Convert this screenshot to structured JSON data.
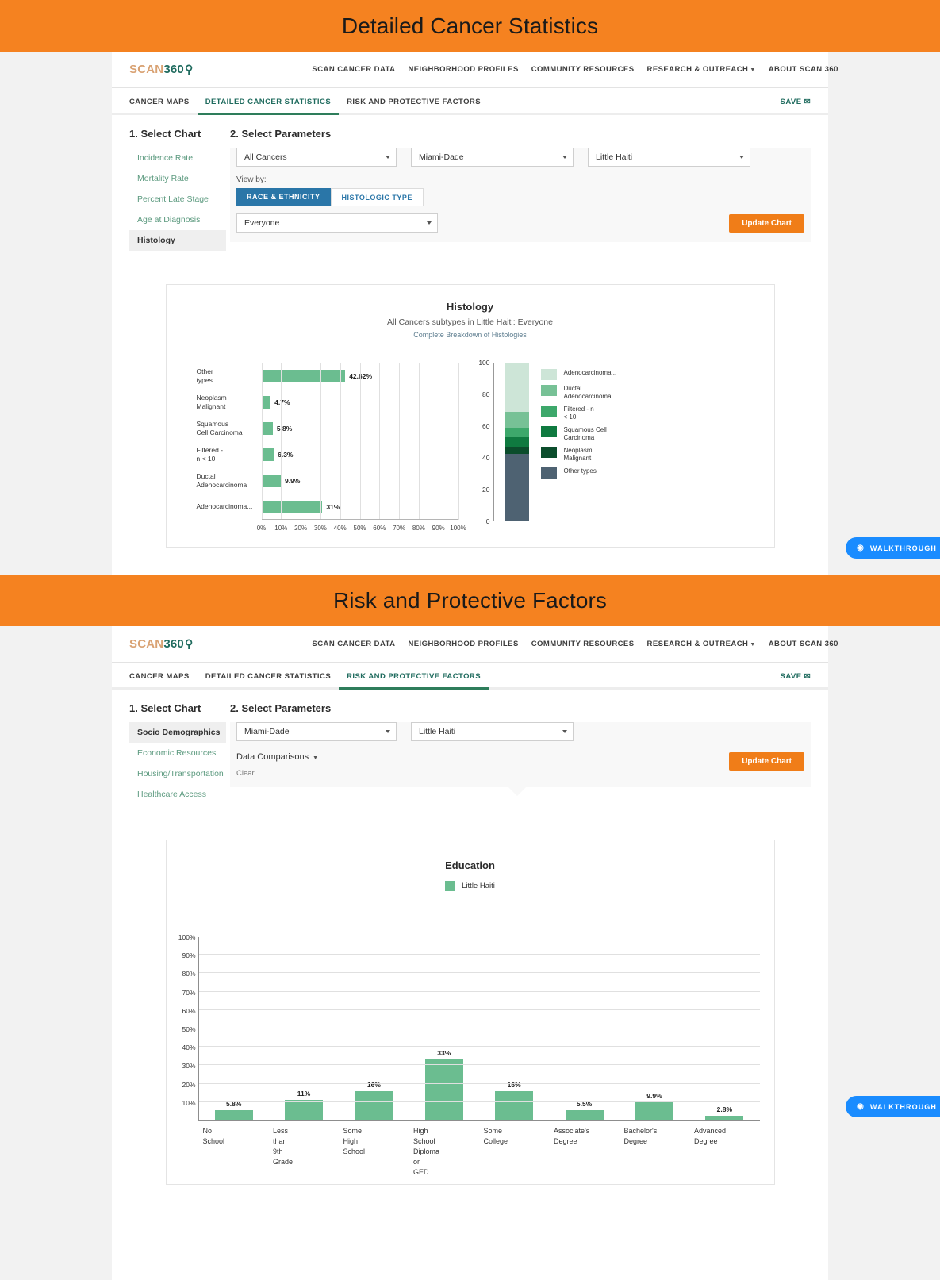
{
  "banners": {
    "top": "Detailed Cancer Statistics",
    "bottom": "Risk and Protective Factors"
  },
  "colors": {
    "banner_orange": "#f58220",
    "button_orange": "#f07d18",
    "bar_green": "#6bbd90",
    "tab_blue": "#2a76a8",
    "walkthrough_blue": "#1a8cff",
    "active_tab_green": "#2e7d5b"
  },
  "brand": {
    "scan": "SCAN",
    "num": "360",
    "glass_icon": "search-icon"
  },
  "mainmenu": [
    "SCAN CANCER DATA",
    "NEIGHBORHOOD PROFILES",
    "COMMUNITY RESOURCES",
    "RESEARCH & OUTREACH",
    "ABOUT SCAN 360"
  ],
  "panel1": {
    "tabs": [
      {
        "label": "CANCER MAPS",
        "active": false
      },
      {
        "label": "DETAILED CANCER STATISTICS",
        "active": true
      },
      {
        "label": "RISK AND PROTECTIVE FACTORS",
        "active": false
      }
    ],
    "save_label": "SAVE",
    "step1_title": "1. Select Chart",
    "step2_title": "2. Select Parameters",
    "chart_list": [
      {
        "label": "Incidence Rate",
        "active": false
      },
      {
        "label": "Mortality Rate",
        "active": false
      },
      {
        "label": "Percent Late Stage",
        "active": false
      },
      {
        "label": "Age at Diagnosis",
        "active": false
      },
      {
        "label": "Histology",
        "active": true
      }
    ],
    "select_cancer": "All Cancers",
    "select_county": "Miami-Dade",
    "select_area": "Little Haiti",
    "view_by_label": "View by:",
    "segtab_on": "RACE & ETHNICITY",
    "segtab_off": "HISTOLOGIC TYPE",
    "select_group": "Everyone",
    "update_button": "Update Chart",
    "walkthrough": "WALKTHROUGH"
  },
  "panel2": {
    "tabs": [
      {
        "label": "CANCER MAPS",
        "active": false
      },
      {
        "label": "DETAILED CANCER STATISTICS",
        "active": false
      },
      {
        "label": "RISK AND PROTECTIVE FACTORS",
        "active": true
      }
    ],
    "save_label": "SAVE",
    "step1_title": "1. Select Chart",
    "step2_title": "2. Select Parameters",
    "chart_list": [
      {
        "label": "Socio Demographics",
        "active": true
      },
      {
        "label": "Economic Resources",
        "active": false
      },
      {
        "label": "Housing/Transportation",
        "active": false
      },
      {
        "label": "Healthcare Access",
        "active": false
      }
    ],
    "select_county": "Miami-Dade",
    "select_area": "Little Haiti",
    "data_comparisons": "Data Comparisons",
    "clear_label": "Clear",
    "update_button": "Update Chart",
    "walkthrough": "WALKTHROUGH"
  },
  "chart_data": [
    {
      "type": "bar",
      "orientation": "horizontal",
      "title": "Histology",
      "subtitle": "All Cancers subtypes in Little Haiti: Everyone",
      "subtitle2": "Complete Breakdown of Histologies",
      "xlabel": "",
      "ylabel": "",
      "xlim": [
        0,
        100
      ],
      "grid": true,
      "xticks": [
        "0%",
        "10%",
        "20%",
        "30%",
        "40%",
        "50%",
        "60%",
        "70%",
        "80%",
        "90%",
        "100%"
      ],
      "categories": [
        "Adenocarcinoma...",
        "Ductal Adenocarcinoma",
        "Filtered - n < 10",
        "Squamous Cell Carcinoma",
        "Neoplasm Malignant",
        "Other types"
      ],
      "values": [
        31,
        9.9,
        6.3,
        5.8,
        4.7,
        42.62
      ],
      "value_labels": [
        "31%",
        "9.9%",
        "6.3%",
        "5.8%",
        "4.7%",
        "42.62%"
      ]
    },
    {
      "type": "bar",
      "orientation": "stacked-vertical",
      "title": "",
      "ylim": [
        0,
        100
      ],
      "yticks": [
        "0",
        "20",
        "40",
        "60",
        "80",
        "100"
      ],
      "legend_position": "right",
      "segments": [
        {
          "name": "Other types",
          "value": 42.62,
          "color": "#4e6272"
        },
        {
          "name": "Neoplasm Malignant",
          "value": 4.7,
          "color": "#0b4d2c"
        },
        {
          "name": "Squamous Cell Carcinoma",
          "value": 5.8,
          "color": "#0f7a40"
        },
        {
          "name": "Filtered - n < 10",
          "value": 6.3,
          "color": "#3da86b"
        },
        {
          "name": "Ductal Adenocarcinoma",
          "value": 9.9,
          "color": "#77c196"
        },
        {
          "name": "Adenocarcinoma...",
          "value": 31,
          "color": "#cde5d7"
        }
      ],
      "legend": [
        {
          "label_line1": "Adenocarcinoma...",
          "label_line2": "",
          "color": "#cde5d7"
        },
        {
          "label_line1": "Ductal",
          "label_line2": "Adenocarcinoma",
          "color": "#77c196"
        },
        {
          "label_line1": "Filtered - n",
          "label_line2": "< 10",
          "color": "#3da86b"
        },
        {
          "label_line1": "Squamous Cell",
          "label_line2": "Carcinoma",
          "color": "#0f7a40"
        },
        {
          "label_line1": "Neoplasm",
          "label_line2": "Malignant",
          "color": "#0b4d2c"
        },
        {
          "label_line1": "Other types",
          "label_line2": "",
          "color": "#4e6272"
        }
      ]
    },
    {
      "type": "bar",
      "orientation": "vertical",
      "title": "Education",
      "legend": [
        "Little Haiti"
      ],
      "legend_position": "top",
      "ylim": [
        0,
        100
      ],
      "grid": true,
      "yticks": [
        "100%",
        "90%",
        "80%",
        "70%",
        "60%",
        "50%",
        "40%",
        "30%",
        "20%",
        "10%"
      ],
      "categories": [
        "No School",
        "Less than 9th Grade",
        "Some High School",
        "High School Diploma or GED",
        "Some College",
        "Associate's Degree",
        "Bachelor's Degree",
        "Advanced Degree"
      ],
      "category_lines": [
        [
          "No",
          "School"
        ],
        [
          "Less",
          "than",
          "9th",
          "Grade"
        ],
        [
          "Some",
          "High",
          "School"
        ],
        [
          "High",
          "School",
          "Diploma",
          "or",
          "GED"
        ],
        [
          "Some",
          "College"
        ],
        [
          "Associate's",
          "Degree"
        ],
        [
          "Bachelor's",
          "Degree"
        ],
        [
          "Advanced",
          "Degree"
        ]
      ],
      "values": [
        5.8,
        11,
        16,
        33,
        16,
        5.5,
        9.9,
        2.8
      ],
      "value_labels": [
        "5.8%",
        "11%",
        "16%",
        "33%",
        "16%",
        "5.5%",
        "9.9%",
        "2.8%"
      ]
    }
  ]
}
